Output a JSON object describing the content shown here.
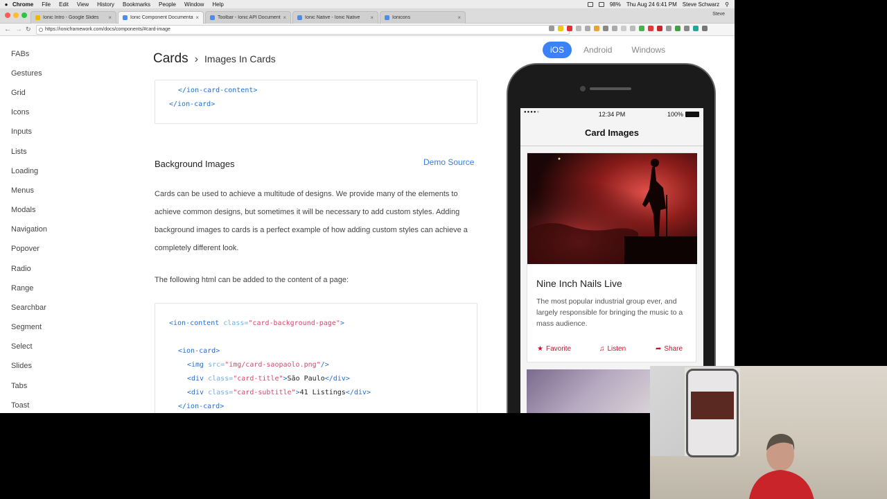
{
  "menubar": {
    "app": "Chrome",
    "items": [
      "File",
      "Edit",
      "View",
      "History",
      "Bookmarks",
      "People",
      "Window",
      "Help"
    ],
    "battery": "98%",
    "datetime": "Thu Aug 24  6:41 PM",
    "user": "Steve Schwarz"
  },
  "tabs": [
    {
      "label": "Ionic Intro - Google Slides",
      "color": "#f4b400"
    },
    {
      "label": "Ionic Component Documentat",
      "color": "#4a8cf0"
    },
    {
      "label": "Toolbar - Ionic API Documenta",
      "color": "#4a8cf0"
    },
    {
      "label": "Ionic Native - Ionic Native",
      "color": "#4a8cf0"
    },
    {
      "label": "Ionicons",
      "color": "#4a8cf0"
    }
  ],
  "profile": "Steve",
  "address": "https://ionicframework.com/docs/components/#card-image",
  "sidebar": {
    "items": [
      "FABs",
      "Gestures",
      "Grid",
      "Icons",
      "Inputs",
      "Lists",
      "Loading",
      "Menus",
      "Modals",
      "Navigation",
      "Popover",
      "Radio",
      "Range",
      "Searchbar",
      "Segment",
      "Select",
      "Slides",
      "Tabs",
      "Toast"
    ]
  },
  "breadcrumb": {
    "section": "Cards",
    "page": "Images In Cards"
  },
  "code1": {
    "line1_tag": "</ion-card-content>",
    "line2_tag": "</ion-card>"
  },
  "section": {
    "title": "Background Images",
    "demo_link": "Demo Source",
    "paragraph": "Cards can be used to achieve a multitude of designs. We provide many of the elements to achieve common designs, but sometimes it will be necessary to add custom styles. Adding background images to cards is a perfect example of how adding custom styles can achieve a completely different look.",
    "paragraph2": "The following html can be added to the content of a page:"
  },
  "code2": {
    "l1_open": "<ion-content",
    "l1_attr": " class=",
    "l1_str": "\"card-background-page\"",
    "l1_close": ">",
    "l2": "<ion-card>",
    "l3_open": "<img",
    "l3_attr": " src=",
    "l3_str": "\"img/card-saopaolo.png\"",
    "l3_close": "/>",
    "l4_open": "<div",
    "l4_attr": " class=",
    "l4_str": "\"card-title\"",
    "l4_text": "São Paulo",
    "l4_close": "</div>",
    "l5_open": "<div",
    "l5_attr": " class=",
    "l5_str": "\"card-subtitle\"",
    "l5_text": "41 Listings",
    "l5_close": "</div>",
    "l6": "</ion-card>"
  },
  "platforms": {
    "ios": "iOS",
    "android": "Android",
    "windows": "Windows"
  },
  "phone": {
    "time": "12:34 PM",
    "battery": "100%",
    "title": "Card Images",
    "card_title": "Nine Inch Nails Live",
    "card_text": "The most popular industrial group ever, and largely responsible for bringing the music to a mass audience.",
    "actions": {
      "favorite": "Favorite",
      "listen": "Listen",
      "share": "Share"
    }
  }
}
